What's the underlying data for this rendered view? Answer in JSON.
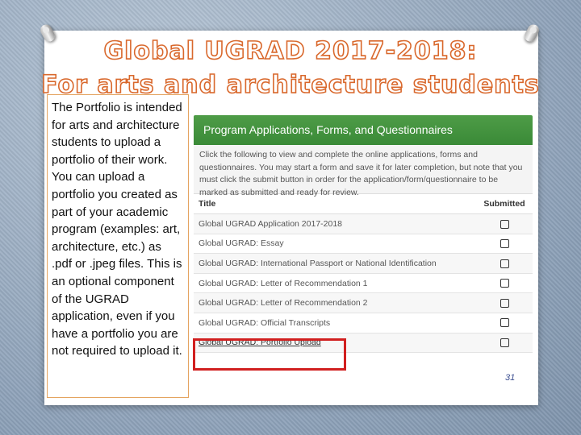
{
  "slide": {
    "title_line1": "Global UGRAD 2017-2018:",
    "title_line2": "For arts and architecture students",
    "description": "The Portfolio is intended for arts and architecture students to upload a portfolio of their work. You can upload a portfolio you created as part of your academic program (examples: art, architecture, etc.) as .pdf or .jpeg files. This is an optional component of the UGRAD application, even if you have a portfolio you are not required to upload it.",
    "page_number": "31"
  },
  "panel": {
    "header": "Program Applications, Forms, and Questionnaires",
    "instructions": "Click the following to view and complete the online applications, forms and questionnaires. You may start a form and save it for later completion, but note that you must click the submit button in order for the application/form/questionnaire to be marked as submitted and ready for review.",
    "columns": {
      "title": "Title",
      "submitted": "Submitted"
    },
    "rows": [
      {
        "title": "Global UGRAD Application 2017-2018"
      },
      {
        "title": "Global UGRAD: Essay"
      },
      {
        "title": "Global UGRAD: International Passport or National Identification"
      },
      {
        "title": "Global UGRAD: Letter of Recommendation 1"
      },
      {
        "title": "Global UGRAD: Letter of Recommendation 2"
      },
      {
        "title": "Global UGRAD: Official Transcripts"
      },
      {
        "title": "Global UGRAD: Portfolio Upload"
      }
    ]
  },
  "colors": {
    "header_green": "#3f8f3b",
    "title_orange": "#d9682c",
    "highlight_red": "#d11f1f"
  }
}
